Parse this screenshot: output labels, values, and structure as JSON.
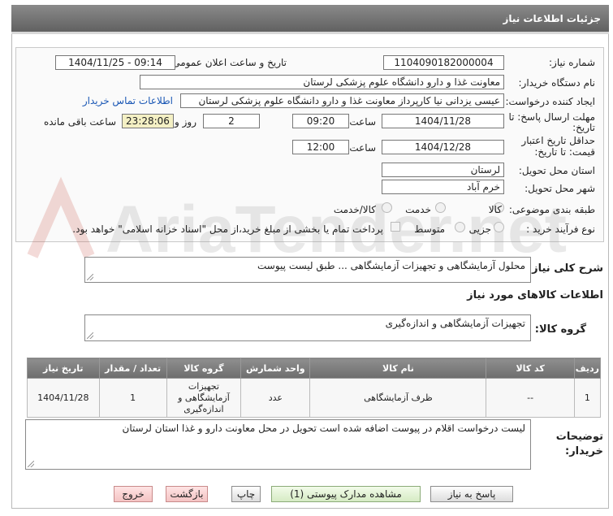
{
  "window": {
    "title": "جزئیات اطلاعات نیاز"
  },
  "watermark": {
    "text": "AriaTender.net"
  },
  "form": {
    "need_number_label": "شماره نیاز:",
    "need_number": "1104090182000004",
    "announce_label": "تاریخ و ساعت اعلان عمومی:",
    "announce_value": "1404/11/25 - 09:14",
    "buyer_org_label": "نام دستگاه خریدار:",
    "buyer_org": "معاونت غذا و دارو دانشگاه علوم پزشکی لرستان",
    "creator_label": "ایجاد کننده درخواست:",
    "creator": "عیسی یزدانی نیا کارپرداز معاونت غذا و دارو دانشگاه علوم پزشکی لرستان",
    "contact_link": "اطلاعات تماس خریدار",
    "deadline_label_1": "مهلت ارسال پاسخ: تا",
    "deadline_label_2": "تاریخ:",
    "deadline_date": "1404/11/28",
    "time_label": "ساعت",
    "deadline_time": "09:20",
    "days_value": "2",
    "days_label": "روز و",
    "remaining_time": "23:28:06",
    "remaining_label": "ساعت باقی مانده",
    "validity_label_1": "حداقل تاریخ اعتبار",
    "validity_label_2": "قیمت: تا تاریخ:",
    "validity_date": "1404/12/28",
    "validity_time_label": "ساعت",
    "validity_time": "12:00",
    "province_label": "استان محل تحویل:",
    "province": "لرستان",
    "city_label": "شهر محل تحویل:",
    "city": "خرم آباد",
    "category_label": "طبقه بندی موضوعی:",
    "category_options": [
      "کالا",
      "خدمت",
      "کالا/خدمت"
    ],
    "process_label": "نوع فرآیند خرید :",
    "process_options": [
      "جزیی",
      "متوسط"
    ],
    "payment_note": "پرداخت تمام یا بخشی از مبلغ خرید،از محل \"اسناد خزانه اسلامی\" خواهد بود."
  },
  "summary": {
    "label": "شرح کلی نیاز:",
    "text": "محلول آزمایشگاهی و تجهیزات آزمایشگاهی ... طبق لیست پیوست"
  },
  "goods_info": {
    "heading": "اطلاعات کالاهای مورد نیاز"
  },
  "goods_group": {
    "label": "گروه کالا:",
    "value": "تجهیزات آزمایشگاهی و اندازه‌گیری"
  },
  "table": {
    "headers": [
      "ردیف",
      "کد کالا",
      "نام کالا",
      "واحد شمارش",
      "گروه کالا",
      "تعداد / مقدار",
      "تاریخ نیاز"
    ],
    "rows": [
      [
        "1",
        "--",
        "ظرف آزمایشگاهی",
        "عدد",
        "تجهیزات آزمایشگاهی و اندازه‌گیری",
        "1",
        "1404/11/28"
      ]
    ]
  },
  "buyer_notes": {
    "label_1": "توضیحات",
    "label_2": "خریدار:",
    "text": "لیست درخواست اقلام در پیوست اضافه شده است تحویل در محل معاونت دارو و غذا استان لرستان"
  },
  "buttons": {
    "reply": "پاسخ به نیاز",
    "view_docs": "مشاهده مدارک پیوستی (1)",
    "print": "چاپ",
    "back": "بازگشت",
    "exit": "خروج"
  }
}
